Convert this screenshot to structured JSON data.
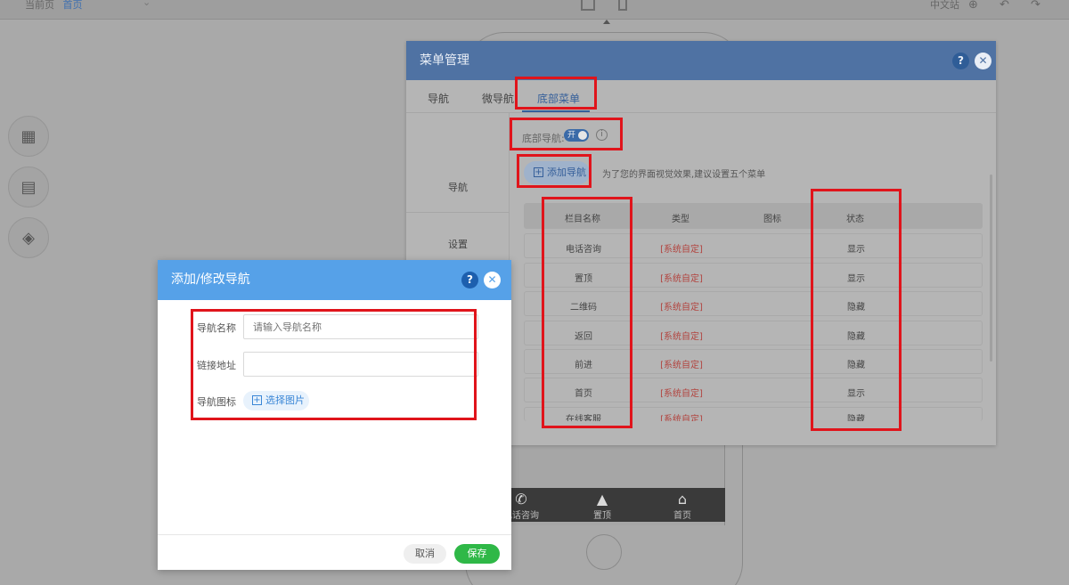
{
  "topbar": {
    "breadcrumb_label": "当前页",
    "breadcrumb_current": "首页",
    "language": "中文站"
  },
  "side_buttons": [
    "widgets-icon",
    "page-icon",
    "layers-icon"
  ],
  "phone_nav": [
    {
      "icon": "phone-icon",
      "label": "电话咨询"
    },
    {
      "icon": "top-arrow-icon",
      "label": "置顶"
    },
    {
      "icon": "home-icon",
      "label": "首页"
    }
  ],
  "menu_modal": {
    "title": "菜单管理",
    "tabs": [
      "导航",
      "微导航",
      "底部菜单"
    ],
    "left_nav": [
      "导航",
      "设置"
    ],
    "switch_label": "底部导航:",
    "switch_state": "开",
    "add_button": "添加导航",
    "hint": "为了您的界面视觉效果,建议设置五个菜单",
    "columns": [
      "栏目名称",
      "类型",
      "图标",
      "状态"
    ],
    "rows": [
      {
        "name": "电话咨询",
        "type": "[系统自定]",
        "status": "显示"
      },
      {
        "name": "置顶",
        "type": "[系统自定]",
        "status": "显示"
      },
      {
        "name": "二维码",
        "type": "[系统自定]",
        "status": "隐藏"
      },
      {
        "name": "返回",
        "type": "[系统自定]",
        "status": "隐藏"
      },
      {
        "name": "前进",
        "type": "[系统自定]",
        "status": "隐藏"
      },
      {
        "name": "首页",
        "type": "[系统自定]",
        "status": "显示"
      },
      {
        "name": "在线客服",
        "type": "[系统自定]",
        "status": "隐藏"
      }
    ]
  },
  "edit_modal": {
    "title": "添加/修改导航",
    "name_label": "导航名称",
    "name_placeholder": "请输入导航名称",
    "url_label": "链接地址",
    "url_value": "",
    "icon_label": "导航图标",
    "pick_image": "选择图片",
    "cancel": "取消",
    "save": "保存"
  },
  "colors": {
    "modal_header_blue": "#56a1e8",
    "save_green": "#2fb847",
    "annotation_red": "#e0141b",
    "system_type_red": "#b2443f"
  }
}
